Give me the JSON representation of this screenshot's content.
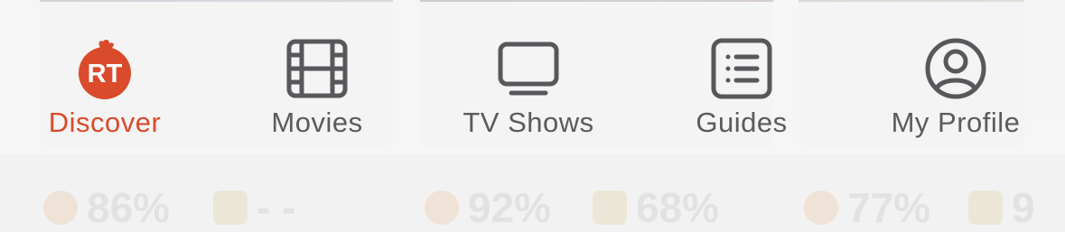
{
  "background": {
    "scores": [
      "86%",
      "- -",
      "92%",
      "68%",
      "77%",
      "9"
    ]
  },
  "tab_bar": {
    "accent_color": "#d94b2b",
    "inactive_color": "#5b5b5f",
    "tabs": [
      {
        "label": "Discover",
        "icon": "rotten-tomatoes-logo-icon",
        "active": true
      },
      {
        "label": "Movies",
        "icon": "film-strip-icon",
        "active": false
      },
      {
        "label": "TV Shows",
        "icon": "tv-icon",
        "active": false
      },
      {
        "label": "Guides",
        "icon": "list-icon",
        "active": false
      },
      {
        "label": "My Profile",
        "icon": "profile-icon",
        "active": false
      }
    ]
  }
}
